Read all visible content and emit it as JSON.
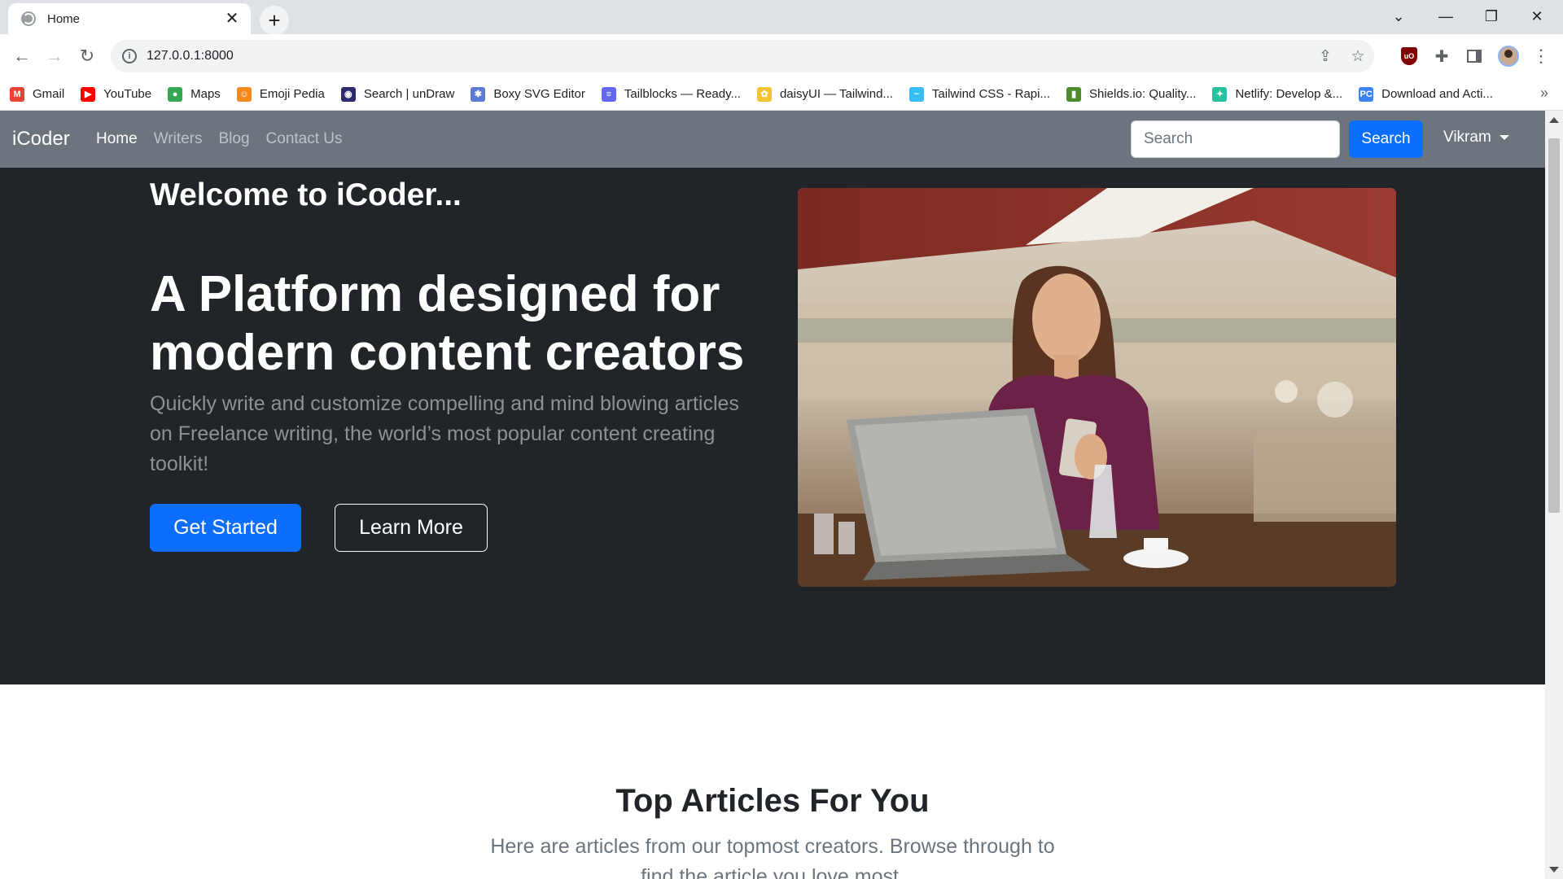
{
  "browser": {
    "tab_title": "Home",
    "tab_close": "✕",
    "new_tab": "+",
    "url": "127.0.0.1:8000",
    "bookmarks": [
      {
        "label": "Gmail",
        "icon": "gmail-icon",
        "color": "#ea4335",
        "glyph": "M"
      },
      {
        "label": "YouTube",
        "icon": "youtube-icon",
        "color": "#ff0000",
        "glyph": "▶"
      },
      {
        "label": "Maps",
        "icon": "maps-icon",
        "color": "#34a853",
        "glyph": "●"
      },
      {
        "label": "Emoji Pedia",
        "icon": "emojipedia-icon",
        "color": "#f28b20",
        "glyph": "☺"
      },
      {
        "label": "Search | unDraw",
        "icon": "undraw-icon",
        "color": "#2d2a6e",
        "glyph": "◉"
      },
      {
        "label": "Boxy SVG Editor",
        "icon": "boxy-icon",
        "color": "#5b7bd5",
        "glyph": "✱"
      },
      {
        "label": "Tailblocks — Ready...",
        "icon": "tailblocks-icon",
        "color": "#6366f1",
        "glyph": "≡"
      },
      {
        "label": "daisyUI — Tailwind...",
        "icon": "daisyui-icon",
        "color": "#f4c430",
        "glyph": "✿"
      },
      {
        "label": "Tailwind CSS - Rapi...",
        "icon": "tailwind-icon",
        "color": "#38bdf8",
        "glyph": "~"
      },
      {
        "label": "Shields.io: Quality...",
        "icon": "shields-icon",
        "color": "#4c8c2b",
        "glyph": "▮"
      },
      {
        "label": "Netlify: Develop &...",
        "icon": "netlify-icon",
        "color": "#25c2a0",
        "glyph": "✦"
      },
      {
        "label": "Download and Acti...",
        "icon": "download-icon",
        "color": "#3b82f6",
        "glyph": "PC"
      }
    ],
    "bookmarks_more": "»"
  },
  "navbar": {
    "brand": "iCoder",
    "links": [
      "Home",
      "Writers",
      "Blog",
      "Contact Us"
    ],
    "active_link": "Home",
    "search_placeholder": "Search",
    "search_button": "Search",
    "user": "Vikram"
  },
  "hero": {
    "welcome": "Welcome to iCoder...",
    "headline": "A Platform designed for modern content creators",
    "lead": "Quickly write and customize compelling and mind blowing articles on Freelance writing, the world’s most popular content creating toolkit!",
    "primary_button": "Get Started",
    "secondary_button": "Learn More"
  },
  "articles": {
    "title": "Top Articles For You",
    "subtitle": "Here are articles from our topmost creators. Browse through to find the article you love most."
  },
  "colors": {
    "navbar_bg": "#6c757d",
    "hero_bg": "#212529",
    "primary": "#0d6efd"
  }
}
